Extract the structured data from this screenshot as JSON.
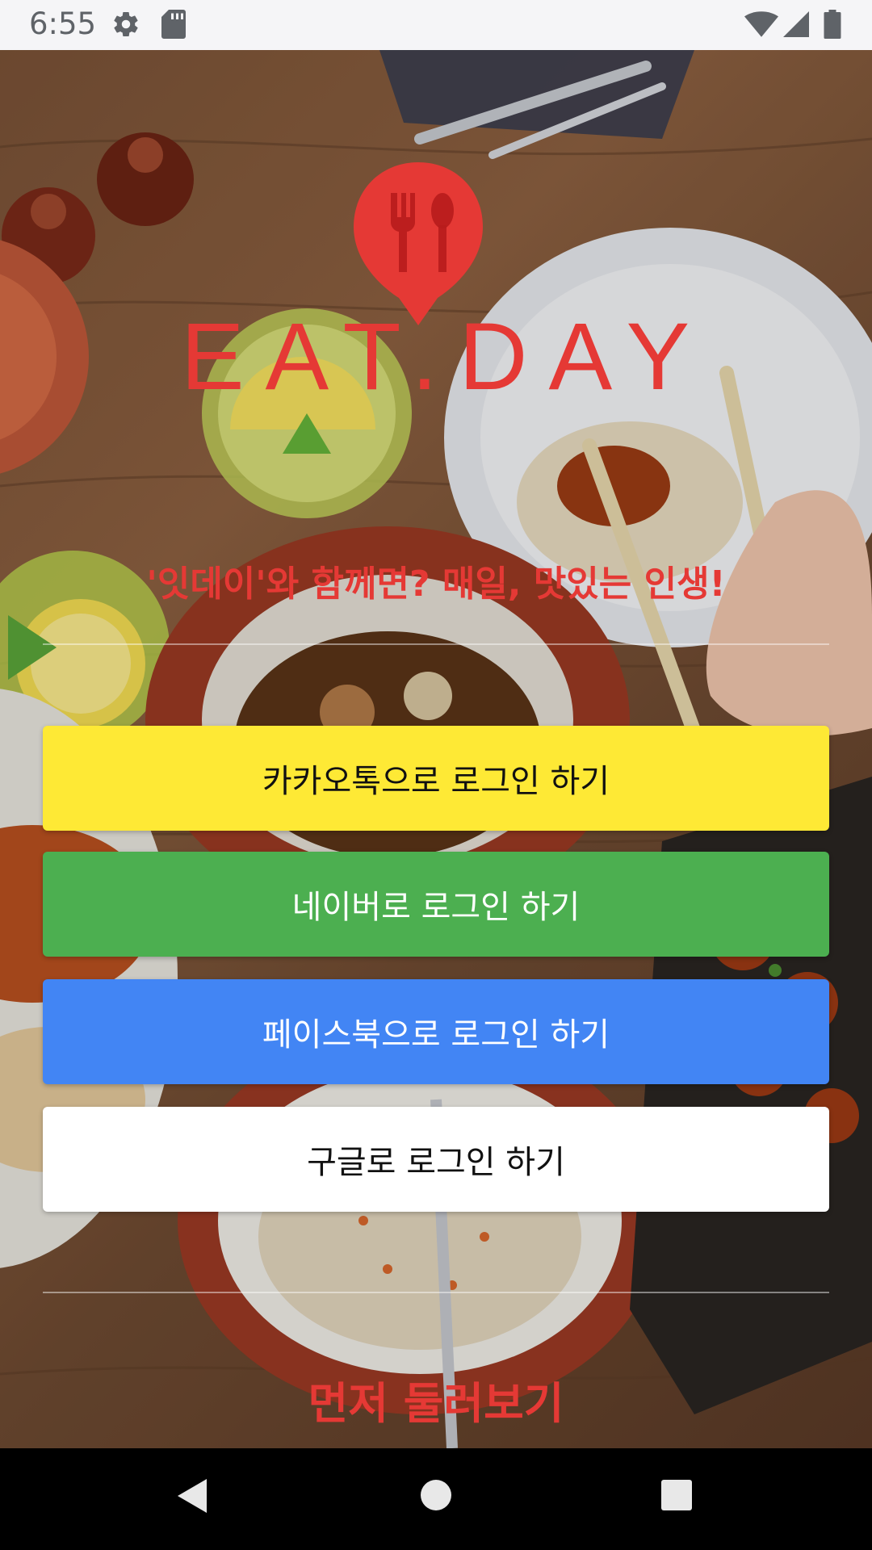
{
  "status_bar": {
    "time": "6:55",
    "icons": [
      "settings-icon",
      "sd-card-icon",
      "wifi-icon",
      "signal-icon",
      "battery-icon"
    ]
  },
  "app": {
    "brand_name": "EAT.DAY",
    "tagline": "'잇데이'와 함께면? 매일, 맛있는 인생!",
    "brand_color": "#e53935"
  },
  "login_buttons": {
    "kakao": {
      "label": "카카오톡으로 로그인 하기",
      "color": "#fee935"
    },
    "naver": {
      "label": "네이버로 로그인 하기",
      "color": "#4caf50"
    },
    "facebook": {
      "label": "페이스북으로 로그인 하기",
      "color": "#4285f4"
    },
    "google": {
      "label": "구글로 로그인 하기",
      "color": "#ffffff"
    }
  },
  "browse_label": "먼저 둘러보기",
  "nav_bar": {
    "buttons": [
      "back-icon",
      "home-icon",
      "recents-icon"
    ]
  }
}
